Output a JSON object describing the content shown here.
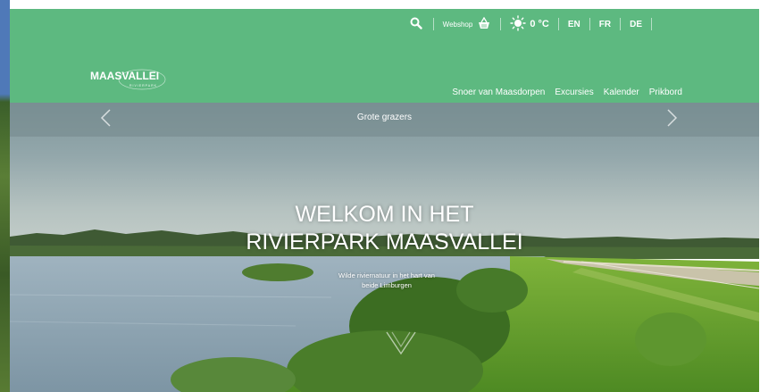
{
  "header": {
    "top": {
      "search_icon": "search-icon",
      "webshop_label": "Webshop",
      "webshop_icon": "basket-icon",
      "weather_icon": "sun-icon",
      "temperature": "0 °C",
      "languages": [
        "EN",
        "FR",
        "DE"
      ]
    },
    "logo_text": "MAASVALLEI",
    "logo_subtext": "RIVIERPARK",
    "nav": [
      "Snoer van Maasdorpen",
      "Excursies",
      "Kalender",
      "Prikbord"
    ]
  },
  "hero": {
    "slide_title": "Grote grazers",
    "heading_line1": "WELKOM IN HET",
    "heading_line2": "RIVIERPARK MAASVALLEI",
    "subtitle_line1": "Wilde riviernatuur in het hart van",
    "subtitle_line2": "beide Limburgen",
    "prev_icon": "chevron-left-icon",
    "next_icon": "chevron-right-icon"
  },
  "colors": {
    "header_green": "#5db980",
    "sky": "#8aa0a6",
    "water": "#8ea6b4",
    "grass": "#6aa82f"
  }
}
